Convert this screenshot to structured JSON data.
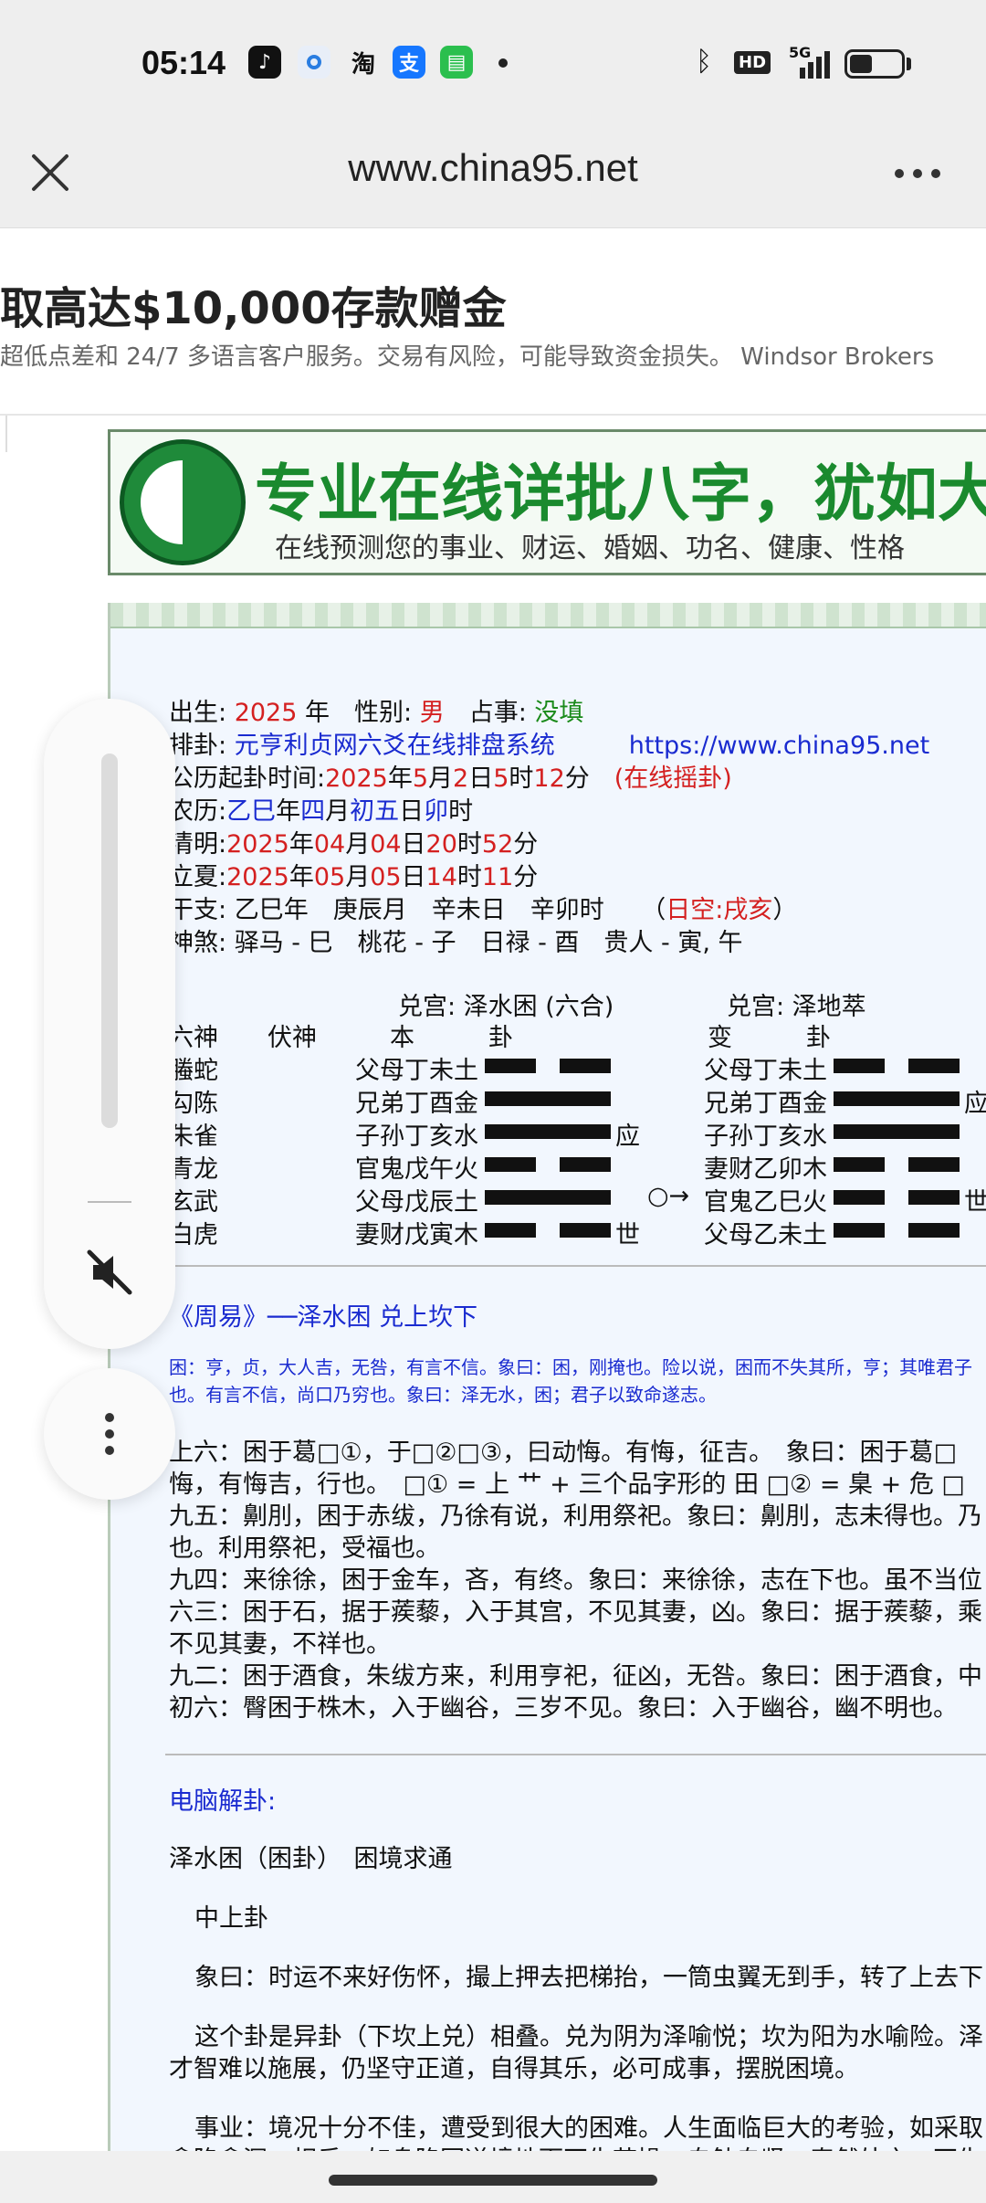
{
  "status": {
    "time": "05:14",
    "apps": [
      "tiktok-icon",
      "browser-icon",
      "taobao-icon",
      "alipay-icon",
      "messages-icon"
    ],
    "taobao": "淘",
    "alipay": "支",
    "network": "5G",
    "hd": "HD",
    "battery_level": 0.45
  },
  "browser": {
    "url": "www.china95.net"
  },
  "ad": {
    "title": "取高达$10,000存款赠金",
    "subtitle": "超低点差和 24/7 多语言客户服务。交易有风险，可能导致资金损失。 Windsor Brokers"
  },
  "banner": {
    "title": "专业在线详批八字，犹如大",
    "subtitle": "在线预测您的事业、财运、婚姻、功名、健康、性格"
  },
  "info": {
    "birth_label": "出生:",
    "birth_year": "2025",
    "year_unit": "年",
    "gender_label": "性别:",
    "gender": "男",
    "divination_label": "占事:",
    "divination": "没填",
    "paigua_label": "排卦:",
    "system_name": "元亨利贞网六爻在线排盘系统",
    "site_url": "https://www.china95.net",
    "time_label": "公历起卦时间:",
    "time_y": "2025",
    "time_m": "5",
    "time_d": "2",
    "time_h": "5",
    "time_min": "12",
    "online": "(在线摇卦)",
    "lunar_label": "农历:",
    "lunar_year": "乙巳",
    "lunar_month": "四",
    "lunar_day": "初五",
    "lunar_hour": "卯",
    "qingming_label": "清明:",
    "qingming_y": "2025",
    "qingming_m": "04",
    "qingming_d": "04",
    "qingming_h": "20",
    "qingming_min": "52",
    "lixia_label": "立夏:",
    "lixia_y": "2025",
    "lixia_m": "05",
    "lixia_d": "05",
    "lixia_h": "14",
    "lixia_min": "11",
    "ganzhi_label": "干支:",
    "ganzhi": "乙巳年　庚辰月　辛未日　辛卯时",
    "kong_label": "日空:",
    "kong": "戌亥",
    "shensha_label": "神煞:",
    "shensha": "驿马 - 巳　桃花 - 子　日禄 - 酉　贵人 - 寅, 午"
  },
  "hexagram": {
    "ben_title": "兑宫:  泽水困 (六合)",
    "bian_title": "兑宫:  泽地萃",
    "h_liushen": "六神",
    "h_fushen": "伏神",
    "h_ben": "本　　　卦",
    "h_bian": "变　　　卦",
    "rows": [
      {
        "liushen": "螣蛇",
        "ben": "父母丁未土",
        "ben_line": "yin",
        "ben_mark": "",
        "change": "",
        "bian": "父母丁未土",
        "bian_line": "yin",
        "bian_mark": ""
      },
      {
        "liushen": "勾陈",
        "ben": "兄弟丁酉金",
        "ben_line": "yang",
        "ben_mark": "",
        "change": "",
        "bian": "兄弟丁酉金",
        "bian_line": "yang",
        "bian_mark": "应"
      },
      {
        "liushen": "朱雀",
        "ben": "子孙丁亥水",
        "ben_line": "yang",
        "ben_mark": "应",
        "change": "",
        "bian": "子孙丁亥水",
        "bian_line": "yang",
        "bian_mark": ""
      },
      {
        "liushen": "青龙",
        "ben": "官鬼戊午火",
        "ben_line": "yin",
        "ben_mark": "",
        "change": "",
        "bian": "妻财乙卯木",
        "bian_line": "yin",
        "bian_mark": ""
      },
      {
        "liushen": "玄武",
        "ben": "父母戊辰土",
        "ben_line": "yang",
        "ben_mark": "",
        "change": "○→",
        "bian": "官鬼乙巳火",
        "bian_line": "yin",
        "bian_mark": "世"
      },
      {
        "liushen": "白虎",
        "ben": "妻财戊寅木",
        "ben_line": "yin",
        "ben_mark": "世",
        "change": "",
        "bian": "父母乙未土",
        "bian_line": "yin",
        "bian_mark": ""
      }
    ]
  },
  "zhouyi": {
    "heading": "《周易》──泽水困 兑上坎下",
    "summary1": "困：亨，贞，大人吉，无咎，有言不信。象曰：困，刚掩也。险以说，困而不失其所，亨；其唯君子",
    "summary2": "也。有言不信，尚口乃穷也。象曰：泽无水，困；君子以致命遂志。",
    "lines": [
      "上六：困于葛□①，于□②□③，曰动悔。有悔，征吉。　象曰：困于葛□",
      "悔，有悔吉，行也。　□① = 上 艹 + 三个品字形的 田 □② = 臬 + 危 □",
      "九五：劓刖，困于赤绂，乃徐有说，利用祭祀。象曰：劓刖，志未得也。乃",
      "也。利用祭祀，受福也。",
      "九四：来徐徐，困于金车，吝，有终。象曰：来徐徐，志在下也。虽不当位",
      "六三：困于石，据于蒺藜，入于其宫，不见其妻，凶。象曰：据于蒺藜，乘",
      "不见其妻，不祥也。",
      "九二：困于酒食，朱绂方来，利用亨祀，征凶，无咎。象曰：困于酒食，中",
      "初六：臀困于株木，入于幽谷，三岁不见。象曰：入于幽谷，幽不明也。"
    ]
  },
  "interpretation": {
    "heading": "电脑解卦:",
    "name": "泽水困（困卦）　困境求通",
    "grade": "中上卦",
    "xiang": "象曰：时运不来好伤怀，撮上押去把梯抬，一筒虫翼无到手，转了上去下",
    "para1a": "这个卦是异卦（下坎上兑）相叠。兑为阴为泽喻悦；坎为阳为水喻险。泽",
    "para1b": "才智难以施展，仍坚守正道，自得其乐，必可成事，摆脱困境。",
    "para2a": "事业：境况十分不佳，遭受到很大的困难。人生面临巨大的考验，如采取",
    "para2b": "愈陷愈深。相反，如身陷困逆境地而不失节操，自勉自坚，泰然处之，不失"
  },
  "floating": {
    "volume_level": 0.0
  }
}
